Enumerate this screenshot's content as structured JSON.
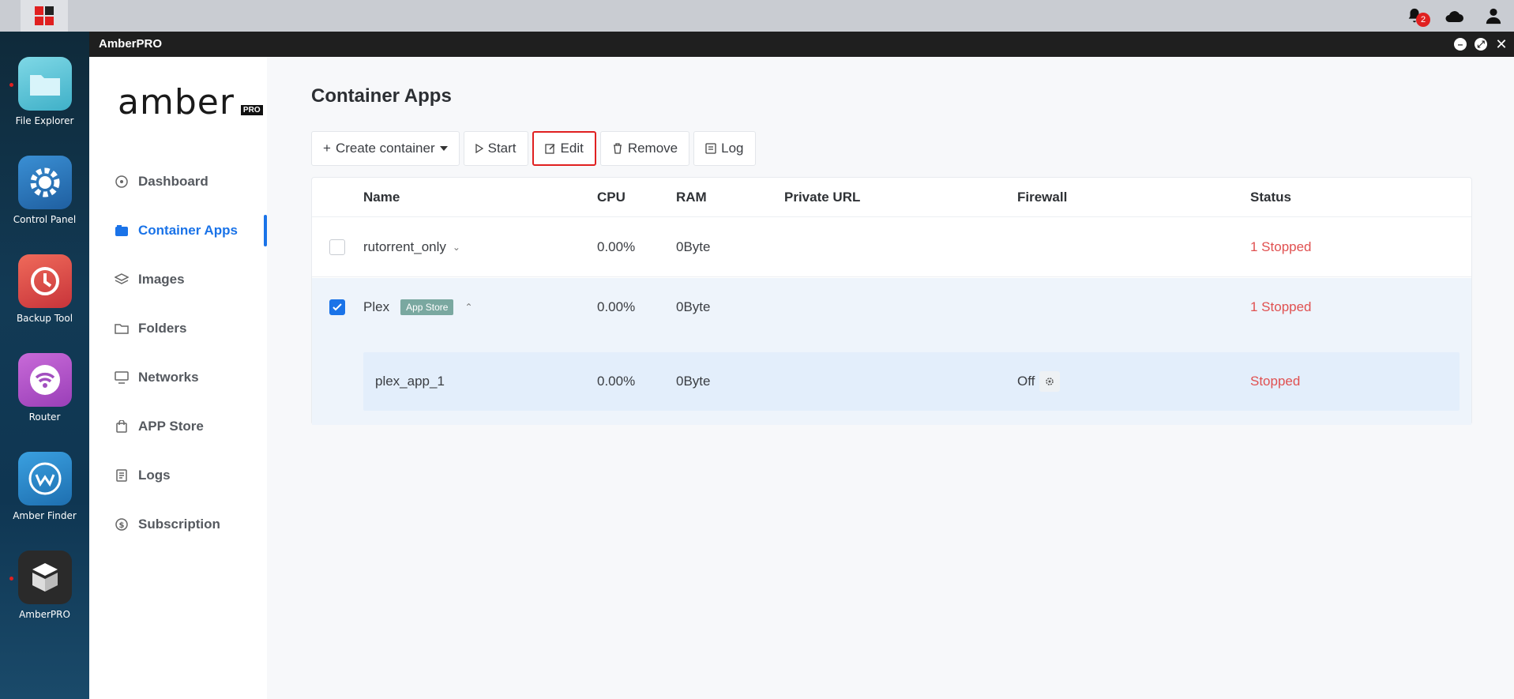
{
  "system": {
    "notification_count": "2"
  },
  "dock": {
    "items": [
      {
        "label": "File Explorer",
        "color": "#5bc3d6"
      },
      {
        "label": "Control Panel",
        "color": "#2e7fc4"
      },
      {
        "label": "Backup Tool",
        "color": "#e0504a"
      },
      {
        "label": "Router",
        "color": "#b453c9"
      },
      {
        "label": "Amber Finder",
        "color": "#2e8fd6"
      },
      {
        "label": "AmberPRO",
        "color": "#2a2a2a"
      }
    ]
  },
  "window": {
    "title": "AmberPRO"
  },
  "brand": {
    "word": "amber",
    "suffix": "PRO"
  },
  "nav": {
    "items": [
      {
        "label": "Dashboard",
        "icon": "dashboard-icon"
      },
      {
        "label": "Container Apps",
        "icon": "container-icon"
      },
      {
        "label": "Images",
        "icon": "layers-icon"
      },
      {
        "label": "Folders",
        "icon": "folder-icon"
      },
      {
        "label": "Networks",
        "icon": "monitor-icon"
      },
      {
        "label": "APP Store",
        "icon": "bag-icon"
      },
      {
        "label": "Logs",
        "icon": "log-icon"
      },
      {
        "label": "Subscription",
        "icon": "dollar-icon"
      }
    ],
    "active": "Container Apps"
  },
  "page": {
    "title": "Container Apps"
  },
  "toolbar": {
    "create": "Create container",
    "start": "Start",
    "edit": "Edit",
    "remove": "Remove",
    "log": "Log"
  },
  "table": {
    "headers": {
      "name": "Name",
      "cpu": "CPU",
      "ram": "RAM",
      "private_url": "Private URL",
      "firewall": "Firewall",
      "status": "Status"
    },
    "rows": [
      {
        "name": "rutorrent_only",
        "cpu": "0.00%",
        "ram": "0Byte",
        "status": "1 Stopped",
        "checked": false
      },
      {
        "name": "Plex",
        "tag": "App Store",
        "cpu": "0.00%",
        "ram": "0Byte",
        "status": "1 Stopped",
        "checked": true
      },
      {
        "name": "plex_app_1",
        "cpu": "0.00%",
        "ram": "0Byte",
        "firewall": "Off",
        "status": "Stopped"
      }
    ]
  },
  "colors": {
    "accent": "#1a73e8",
    "status_stopped": "#e05050",
    "tag_bg": "#7aa8a0"
  }
}
